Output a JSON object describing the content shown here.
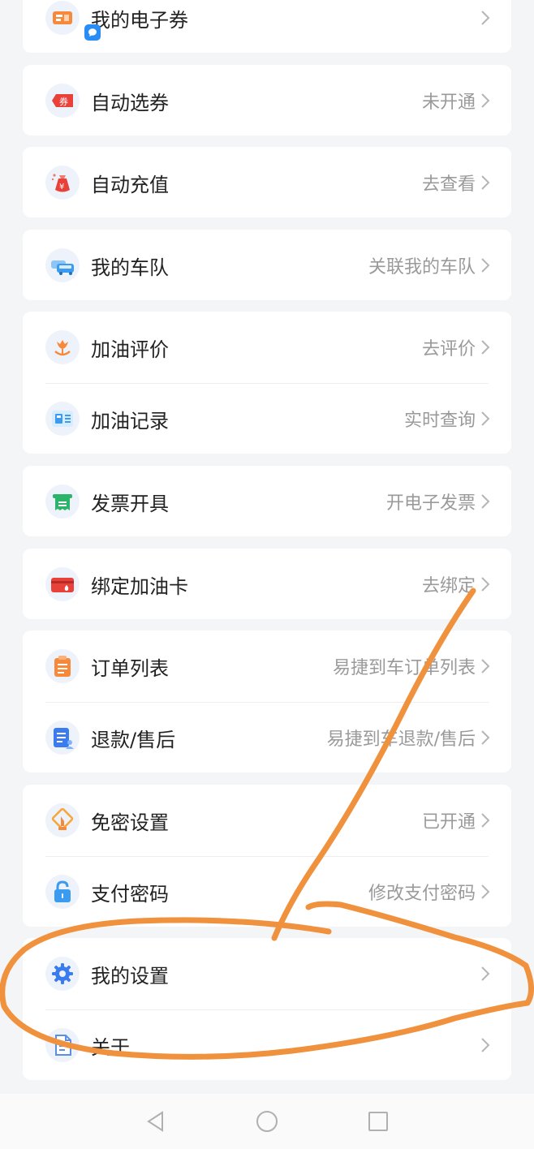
{
  "colors": {
    "background": "#f4f5f7",
    "annotation": "#f0913e",
    "value_text": "#9a9a9a"
  },
  "items": {
    "coupons": {
      "label": "我的电子券",
      "value": "",
      "icon": "ticket-icon"
    },
    "auto_coupon": {
      "label": "自动选券",
      "value": "未开通",
      "icon": "coupon-icon"
    },
    "auto_topup": {
      "label": "自动充值",
      "value": "去查看",
      "icon": "money-bag-icon"
    },
    "fleet": {
      "label": "我的车队",
      "value": "关联我的车队",
      "icon": "car-icon"
    },
    "review": {
      "label": "加油评价",
      "value": "去评价",
      "icon": "flower-icon"
    },
    "records": {
      "label": "加油记录",
      "value": "实时查询",
      "icon": "fuel-record-icon"
    },
    "invoice": {
      "label": "发票开具",
      "value": "开电子发票",
      "icon": "invoice-icon"
    },
    "bind_card": {
      "label": "绑定加油卡",
      "value": "去绑定",
      "icon": "fuel-card-icon"
    },
    "orders": {
      "label": "订单列表",
      "value": "易捷到车订单列表",
      "icon": "clipboard-icon"
    },
    "refund": {
      "label": "退款/售后",
      "value": "易捷到车退款/售后",
      "icon": "refund-doc-icon"
    },
    "no_pwd": {
      "label": "免密设置",
      "value": "已开通",
      "icon": "tap-pay-icon"
    },
    "pay_pwd": {
      "label": "支付密码",
      "value": "修改支付密码",
      "icon": "lock-icon"
    },
    "settings": {
      "label": "我的设置",
      "value": "",
      "icon": "gear-icon"
    },
    "about": {
      "label": "关于",
      "value": "",
      "icon": "document-icon"
    }
  },
  "navbar": {
    "icons": [
      "back-icon",
      "home-icon",
      "recents-icon"
    ]
  }
}
